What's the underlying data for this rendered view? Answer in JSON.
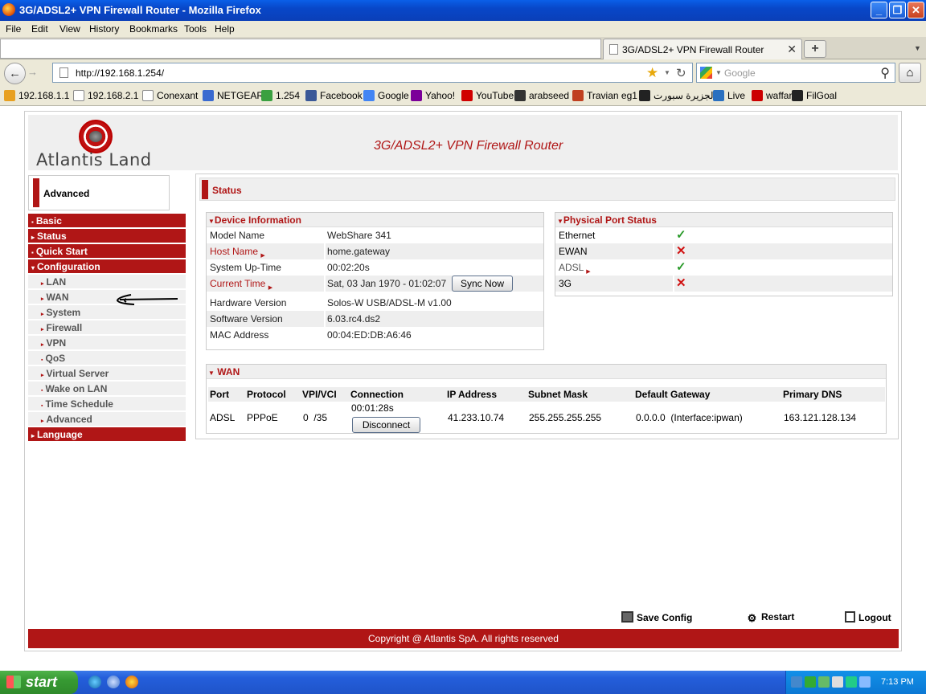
{
  "window": {
    "title": "3G/ADSL2+ VPN Firewall Router - Mozilla Firefox",
    "controls": {
      "minimize": "_",
      "maximize": "❐",
      "close": "✕"
    }
  },
  "menubar": [
    "File",
    "Edit",
    "View",
    "History",
    "Bookmarks",
    "Tools",
    "Help"
  ],
  "tab": {
    "label": "3G/ADSL2+ VPN Firewall Router",
    "close": "✕",
    "new": "+"
  },
  "navbar": {
    "url": "http://192.168.1.254/",
    "search_placeholder": "Google"
  },
  "bookmarks": [
    {
      "label": "192.168.1.1",
      "icon": "folder-icon",
      "color": "#e8a020"
    },
    {
      "label": "192.168.2.1",
      "icon": "page-icon",
      "color": "#ffffff"
    },
    {
      "label": "Conexant",
      "icon": "page-icon",
      "color": "#ffffff"
    },
    {
      "label": "NETGEAR",
      "icon": "netgear-icon",
      "color": "#3a6ad0"
    },
    {
      "label": "1.254",
      "icon": "grid-icon",
      "color": "#3aa040"
    },
    {
      "label": "Facebook",
      "icon": "facebook-icon",
      "color": "#3b5998"
    },
    {
      "label": "Google",
      "icon": "google-icon",
      "color": "#4285f4"
    },
    {
      "label": "Yahoo!",
      "icon": "yahoo-icon",
      "color": "#7b0099"
    },
    {
      "label": "YouTube",
      "icon": "youtube-icon",
      "color": "#d00000"
    },
    {
      "label": "arabseed",
      "icon": "arabseed-icon",
      "color": "#333333"
    },
    {
      "label": "Travian eg1",
      "icon": "travian-icon",
      "color": "#c04020"
    },
    {
      "label": "الجزيرة سبورت",
      "icon": "ball-icon",
      "color": "#222222"
    },
    {
      "label": "Live",
      "icon": "live-icon",
      "color": "#2a70c0"
    },
    {
      "label": "waffar",
      "icon": "waffar-icon",
      "color": "#cc0000"
    },
    {
      "label": "FilGoal",
      "icon": "ball-icon",
      "color": "#222222"
    }
  ],
  "router": {
    "logo_text": "Atlantis Land",
    "product_title": "3G/ADSL2+ VPN Firewall Router",
    "mode_label": "Advanced",
    "page_heading": "Status"
  },
  "sidebar": {
    "main": [
      {
        "label": "Basic",
        "marker": "▪"
      },
      {
        "label": "Status",
        "marker": "▸"
      },
      {
        "label": "Quick Start",
        "marker": "▪"
      },
      {
        "label": "Configuration",
        "marker": "▾"
      }
    ],
    "sub": [
      {
        "label": "LAN",
        "marker": "▸"
      },
      {
        "label": "WAN",
        "marker": "▸"
      },
      {
        "label": "System",
        "marker": "▸"
      },
      {
        "label": "Firewall",
        "marker": "▸"
      },
      {
        "label": "VPN",
        "marker": "▸"
      },
      {
        "label": "QoS",
        "marker": "▪"
      },
      {
        "label": "Virtual Server",
        "marker": "▸"
      },
      {
        "label": "Wake on LAN",
        "marker": "▪"
      },
      {
        "label": "Time Schedule",
        "marker": "▪"
      },
      {
        "label": "Advanced",
        "marker": "▸"
      }
    ],
    "language": {
      "label": "Language",
      "marker": "▸"
    }
  },
  "device_info": {
    "heading": "Device Information",
    "model_name_label": "Model Name",
    "model_name": "WebShare 341",
    "host_name_label": "Host Name",
    "host_name": "home.gateway",
    "uptime_label": "System Up-Time",
    "uptime": "00:02:20s",
    "current_time_label": "Current Time",
    "current_time": "Sat, 03 Jan 1970 - 01:02:07",
    "sync_button": "Sync Now",
    "hw_label": "Hardware Version",
    "hw": "Solos-W USB/ADSL-M v1.00",
    "sw_label": "Software Version",
    "sw": "6.03.rc4.ds2",
    "mac_label": "MAC Address",
    "mac": "00:04:ED:DB:A6:46"
  },
  "ports": {
    "heading": "Physical Port Status",
    "items": [
      {
        "label": "Ethernet",
        "status": "✓"
      },
      {
        "label": "EWAN",
        "status": "✕"
      },
      {
        "label": "ADSL",
        "status": "✓"
      },
      {
        "label": "3G",
        "status": "✕"
      }
    ]
  },
  "wan": {
    "heading": "WAN",
    "columns": [
      "Port",
      "Protocol",
      "VPI/VCI",
      "Connection",
      "IP Address",
      "Subnet Mask",
      "Default Gateway",
      "Primary DNS"
    ],
    "row": {
      "port": "ADSL",
      "protocol": "PPPoE",
      "vpi_vci": "0  /35",
      "connection_time": "00:01:28s",
      "disconnect_button": "Disconnect",
      "ip": "41.233.10.74",
      "mask": "255.255.255.255",
      "gateway": "0.0.0.0  (Interface:ipwan)",
      "dns": "163.121.128.134"
    }
  },
  "footer": {
    "save": "Save Config",
    "restart": "Restart",
    "logout": "Logout",
    "copyright": "Copyright @ Atlantis SpA. All rights reserved"
  },
  "taskbar": {
    "start": "start",
    "clock": "7:13 PM"
  }
}
